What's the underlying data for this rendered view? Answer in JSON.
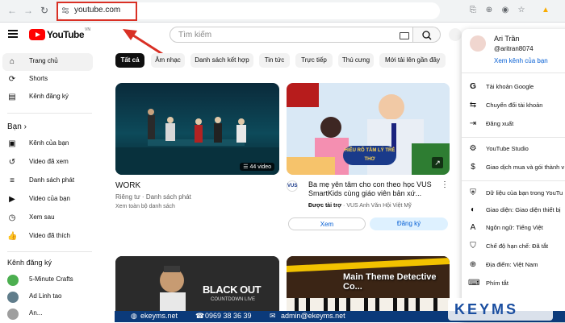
{
  "browser": {
    "url": "youtube.com"
  },
  "header": {
    "logo_text": "YouTube",
    "logo_region": "VN",
    "search_placeholder": "Tìm kiếm"
  },
  "sidebar": {
    "main": [
      {
        "label": "Trang chủ",
        "icon": "home-icon"
      },
      {
        "label": "Shorts",
        "icon": "shorts-icon"
      },
      {
        "label": "Kênh đăng ký",
        "icon": "subscriptions-icon"
      }
    ],
    "you_title": "Bạn",
    "you": [
      {
        "label": "Kênh của bạn",
        "icon": "channel-icon"
      },
      {
        "label": "Video đã xem",
        "icon": "history-icon"
      },
      {
        "label": "Danh sách phát",
        "icon": "playlist-icon"
      },
      {
        "label": "Video của bạn",
        "icon": "your-videos-icon"
      },
      {
        "label": "Xem sau",
        "icon": "watch-later-icon"
      },
      {
        "label": "Video đã thích",
        "icon": "liked-icon"
      }
    ],
    "subs_title": "Kênh đăng ký",
    "subs": [
      {
        "label": "5-Minute Crafts",
        "color": "#4caf50"
      },
      {
        "label": "Ad Linh tao",
        "color": "#607d8b"
      },
      {
        "label": "An...",
        "color": "#9e9e9e"
      }
    ]
  },
  "chips": [
    "Tất cả",
    "Âm nhạc",
    "Danh sách kết hợp",
    "Tin tức",
    "Trực tiếp",
    "Thú cưng",
    "Mới tải lên gần đây"
  ],
  "videos": [
    {
      "title": "WORK",
      "meta1": "Riêng tư · Danh sách phát",
      "meta2": "Xem toàn bộ danh sách",
      "badge": "44 video"
    },
    {
      "title": "Ba mẹ yên tâm cho con theo học VUS SmartKids cùng giáo viên bản xứ...",
      "sponsor": "Được tài trợ",
      "channel": "· VUS Anh Văn Hội Việt Mỹ",
      "thumb_text": "HIỂU RÕ TÂM LÝ TRẺ THƠ",
      "btn_watch": "Xem",
      "btn_signup": "Đăng ký"
    },
    {
      "thumb_text": "BLACK OUT",
      "thumb_sub": "COUNTDOWN LIVE"
    },
    {
      "thumb_text": "Main Theme Detective Co..."
    }
  ],
  "account": {
    "name": "Ari Trần",
    "handle": "@aritran8074",
    "view_channel": "Xem kênh của bạn",
    "group1": [
      {
        "label": "Tài khoản Google",
        "icon": "google-icon"
      },
      {
        "label": "Chuyển đổi tài khoản",
        "icon": "switch-account-icon"
      },
      {
        "label": "Đăng xuất",
        "icon": "sign-out-icon"
      }
    ],
    "group2": [
      {
        "label": "YouTube Studio",
        "icon": "studio-icon"
      },
      {
        "label": "Giao dịch mua và gói thành v",
        "icon": "dollar-icon"
      }
    ],
    "group3": [
      {
        "label": "Dữ liệu của bạn trong YouTu",
        "icon": "data-icon"
      },
      {
        "label": "Giao diện: Giao diện thiết bị",
        "icon": "theme-icon"
      },
      {
        "label": "Ngôn ngữ: Tiếng Việt",
        "icon": "language-icon"
      },
      {
        "label": "Chế độ hạn chế: Đã tắt",
        "icon": "restricted-icon"
      },
      {
        "label": "Địa điểm: Việt Nam",
        "icon": "globe-icon"
      },
      {
        "label": "Phím tắt",
        "icon": "keyboard-icon"
      }
    ]
  },
  "banner": {
    "site": "ekeyms.net",
    "phone": "0969 38 36 39",
    "email": "admin@ekeyms.net",
    "brand": "KEYMS"
  }
}
